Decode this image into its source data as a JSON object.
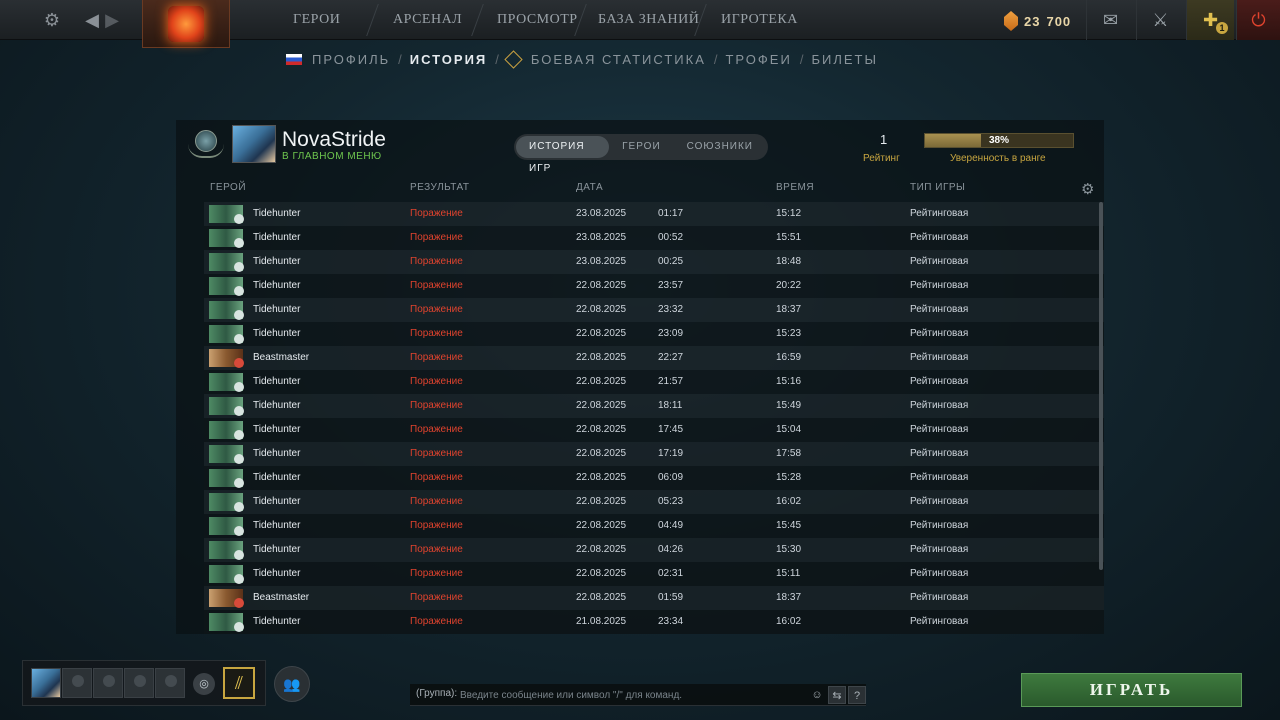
{
  "topbar": {
    "nav": [
      "ГЕРОИ",
      "АРСЕНАЛ",
      "ПРОСМОТР",
      "БАЗА ЗНАНИЙ",
      "ИГРОТЕКА"
    ],
    "currency": {
      "amount_a": "23",
      "amount_b": "700"
    },
    "plus_badge": "1"
  },
  "subnav": {
    "items": [
      "ПРОФИЛЬ",
      "ИСТОРИЯ",
      "БОЕВАЯ СТАТИСТИКА",
      "ТРОФЕИ",
      "БИЛЕТЫ"
    ],
    "active_index": 1
  },
  "profile": {
    "name": "NovaStride",
    "status": "В ГЛАВНОМ МЕНЮ",
    "tabs": [
      "ИСТОРИЯ ИГР",
      "ГЕРОИ",
      "СОЮЗНИКИ"
    ],
    "active_tab": 0,
    "rating_value": "1",
    "rating_label": "Рейтинг",
    "confidence_text": "38%",
    "confidence_fraction": 0.38,
    "confidence_label": "Уверенность в ранге"
  },
  "table": {
    "headers": {
      "hero": "ГЕРОЙ",
      "result": "РЕЗУЛЬТАТ",
      "date": "ДАТА",
      "duration": "ВРЕМЯ",
      "type": "ТИП ИГРЫ"
    },
    "rows": [
      {
        "hero": "Tidehunter",
        "result": "Поражение",
        "date": "23.08.2025",
        "time": "01:17",
        "duration": "15:12",
        "type": "Рейтинговая"
      },
      {
        "hero": "Tidehunter",
        "result": "Поражение",
        "date": "23.08.2025",
        "time": "00:52",
        "duration": "15:51",
        "type": "Рейтинговая"
      },
      {
        "hero": "Tidehunter",
        "result": "Поражение",
        "date": "23.08.2025",
        "time": "00:25",
        "duration": "18:48",
        "type": "Рейтинговая"
      },
      {
        "hero": "Tidehunter",
        "result": "Поражение",
        "date": "22.08.2025",
        "time": "23:57",
        "duration": "20:22",
        "type": "Рейтинговая"
      },
      {
        "hero": "Tidehunter",
        "result": "Поражение",
        "date": "22.08.2025",
        "time": "23:32",
        "duration": "18:37",
        "type": "Рейтинговая"
      },
      {
        "hero": "Tidehunter",
        "result": "Поражение",
        "date": "22.08.2025",
        "time": "23:09",
        "duration": "15:23",
        "type": "Рейтинговая"
      },
      {
        "hero": "Beastmaster",
        "result": "Поражение",
        "date": "22.08.2025",
        "time": "22:27",
        "duration": "16:59",
        "type": "Рейтинговая"
      },
      {
        "hero": "Tidehunter",
        "result": "Поражение",
        "date": "22.08.2025",
        "time": "21:57",
        "duration": "15:16",
        "type": "Рейтинговая"
      },
      {
        "hero": "Tidehunter",
        "result": "Поражение",
        "date": "22.08.2025",
        "time": "18:11",
        "duration": "15:49",
        "type": "Рейтинговая"
      },
      {
        "hero": "Tidehunter",
        "result": "Поражение",
        "date": "22.08.2025",
        "time": "17:45",
        "duration": "15:04",
        "type": "Рейтинговая"
      },
      {
        "hero": "Tidehunter",
        "result": "Поражение",
        "date": "22.08.2025",
        "time": "17:19",
        "duration": "17:58",
        "type": "Рейтинговая"
      },
      {
        "hero": "Tidehunter",
        "result": "Поражение",
        "date": "22.08.2025",
        "time": "06:09",
        "duration": "15:28",
        "type": "Рейтинговая"
      },
      {
        "hero": "Tidehunter",
        "result": "Поражение",
        "date": "22.08.2025",
        "time": "05:23",
        "duration": "16:02",
        "type": "Рейтинговая"
      },
      {
        "hero": "Tidehunter",
        "result": "Поражение",
        "date": "22.08.2025",
        "time": "04:49",
        "duration": "15:45",
        "type": "Рейтинговая"
      },
      {
        "hero": "Tidehunter",
        "result": "Поражение",
        "date": "22.08.2025",
        "time": "04:26",
        "duration": "15:30",
        "type": "Рейтинговая"
      },
      {
        "hero": "Tidehunter",
        "result": "Поражение",
        "date": "22.08.2025",
        "time": "02:31",
        "duration": "15:11",
        "type": "Рейтинговая"
      },
      {
        "hero": "Beastmaster",
        "result": "Поражение",
        "date": "22.08.2025",
        "time": "01:59",
        "duration": "18:37",
        "type": "Рейтинговая"
      },
      {
        "hero": "Tidehunter",
        "result": "Поражение",
        "date": "21.08.2025",
        "time": "23:34",
        "duration": "16:02",
        "type": "Рейтинговая"
      }
    ]
  },
  "chat": {
    "label": "(Группа):",
    "placeholder": "Введите сообщение или символ \"/\" для команд.",
    "help": "?"
  },
  "play_button": "ИГРАТЬ",
  "icons": {
    "settings": "gear-icon",
    "back": "arrow-left-icon",
    "forward": "arrow-right-icon",
    "mail": "mail-icon",
    "armory": "swords-icon",
    "plus": "dota-plus-icon",
    "power": "power-icon",
    "column_settings": "gear-icon",
    "voice": "headset-icon",
    "shards": "shard-icon",
    "group": "group-icon",
    "emoji": "emoji-icon",
    "chat_wheel": "chatwheel-icon"
  },
  "colors": {
    "loss": "#e0432e",
    "accent_gold": "#c8a640",
    "status_green": "#6ec64e",
    "play_green": "#3e7a3e"
  }
}
